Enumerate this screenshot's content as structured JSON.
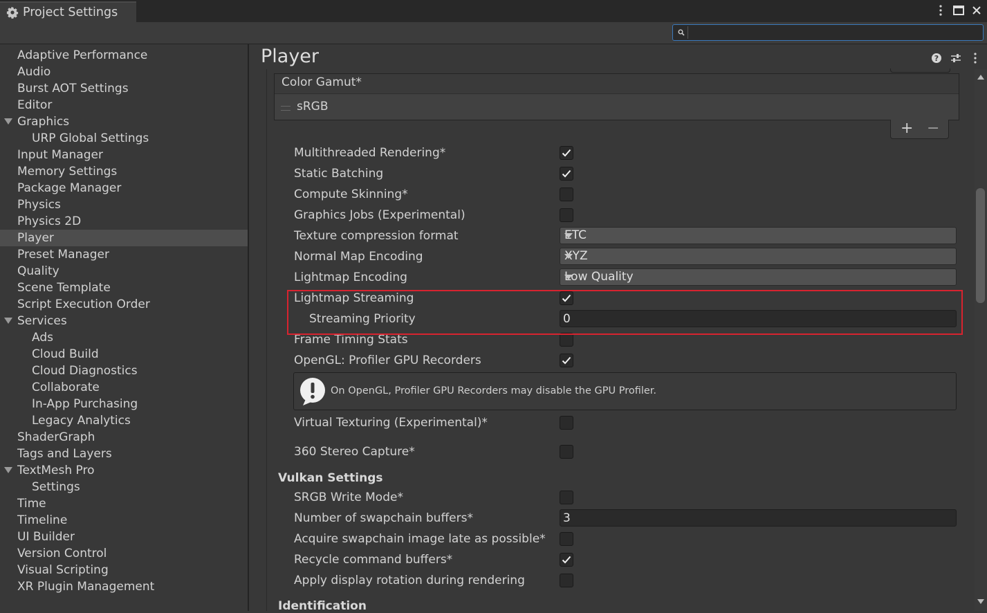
{
  "window": {
    "tab_title": "Project Settings",
    "controls": [
      "more-icon",
      "maximize-icon",
      "close-icon"
    ]
  },
  "search": {
    "placeholder": "",
    "value": ""
  },
  "sidebar": {
    "items": [
      {
        "label": "Adaptive Performance",
        "level": 0
      },
      {
        "label": "Audio",
        "level": 0
      },
      {
        "label": "Burst AOT Settings",
        "level": 0
      },
      {
        "label": "Editor",
        "level": 0
      },
      {
        "label": "Graphics",
        "level": 0,
        "expanded": true
      },
      {
        "label": "URP Global Settings",
        "level": 1
      },
      {
        "label": "Input Manager",
        "level": 0
      },
      {
        "label": "Memory Settings",
        "level": 0
      },
      {
        "label": "Package Manager",
        "level": 0
      },
      {
        "label": "Physics",
        "level": 0
      },
      {
        "label": "Physics 2D",
        "level": 0
      },
      {
        "label": "Player",
        "level": 0,
        "selected": true
      },
      {
        "label": "Preset Manager",
        "level": 0
      },
      {
        "label": "Quality",
        "level": 0
      },
      {
        "label": "Scene Template",
        "level": 0
      },
      {
        "label": "Script Execution Order",
        "level": 0
      },
      {
        "label": "Services",
        "level": 0,
        "expanded": true
      },
      {
        "label": "Ads",
        "level": 1
      },
      {
        "label": "Cloud Build",
        "level": 1
      },
      {
        "label": "Cloud Diagnostics",
        "level": 1
      },
      {
        "label": "Collaborate",
        "level": 1
      },
      {
        "label": "In-App Purchasing",
        "level": 1
      },
      {
        "label": "Legacy Analytics",
        "level": 1
      },
      {
        "label": "ShaderGraph",
        "level": 0
      },
      {
        "label": "Tags and Layers",
        "level": 0
      },
      {
        "label": "TextMesh Pro",
        "level": 0,
        "expanded": true
      },
      {
        "label": "Settings",
        "level": 1
      },
      {
        "label": "Time",
        "level": 0
      },
      {
        "label": "Timeline",
        "level": 0
      },
      {
        "label": "UI Builder",
        "level": 0
      },
      {
        "label": "Version Control",
        "level": 0
      },
      {
        "label": "Visual Scripting",
        "level": 0
      },
      {
        "label": "XR Plugin Management",
        "level": 0
      }
    ]
  },
  "main": {
    "title": "Player",
    "header_icons": [
      "help-icon",
      "presets-icon",
      "more-icon"
    ],
    "color_gamut": {
      "header": "Color Gamut*",
      "entries": [
        "sRGB"
      ],
      "add_label": "+",
      "remove_label": "−"
    },
    "rows": {
      "multithreaded": {
        "label": "Multithreaded Rendering*",
        "checked": true
      },
      "static_batching": {
        "label": "Static Batching",
        "checked": true
      },
      "compute_skinning": {
        "label": "Compute Skinning*",
        "checked": false
      },
      "graphics_jobs": {
        "label": "Graphics Jobs (Experimental)",
        "checked": false
      },
      "texture_compression": {
        "label": "Texture compression format",
        "value": "ETC"
      },
      "normal_map": {
        "label": "Normal Map Encoding",
        "value": "XYZ"
      },
      "lightmap_encoding": {
        "label": "Lightmap Encoding",
        "value": "Low Quality"
      },
      "lightmap_streaming": {
        "label": "Lightmap Streaming",
        "checked": true
      },
      "streaming_priority": {
        "label": "Streaming Priority",
        "value": "0"
      },
      "frame_timing": {
        "label": "Frame Timing Stats",
        "checked": false
      },
      "opengl_recorders": {
        "label": "OpenGL: Profiler GPU Recorders",
        "checked": true
      },
      "virtual_texturing": {
        "label": "Virtual Texturing (Experimental)*",
        "checked": false
      },
      "stereo_capture": {
        "label": "360 Stereo Capture*",
        "checked": false
      }
    },
    "help_message": "On OpenGL, Profiler GPU Recorders may disable the GPU Profiler.",
    "vulkan": {
      "title": "Vulkan Settings",
      "srgb_write": {
        "label": "SRGB Write Mode*",
        "checked": false
      },
      "swapchain_buffers": {
        "label": "Number of swapchain buffers*",
        "value": "3"
      },
      "acquire_late": {
        "label": "Acquire swapchain image late as possible*",
        "checked": false
      },
      "recycle_buffers": {
        "label": "Recycle command buffers*",
        "checked": true
      },
      "display_rotation": {
        "label": "Apply display rotation during rendering",
        "checked": false
      }
    },
    "next_section": "Identification"
  },
  "colors": {
    "highlight": "#d8232f",
    "search_border": "#3a79bb",
    "background": "#383838"
  }
}
